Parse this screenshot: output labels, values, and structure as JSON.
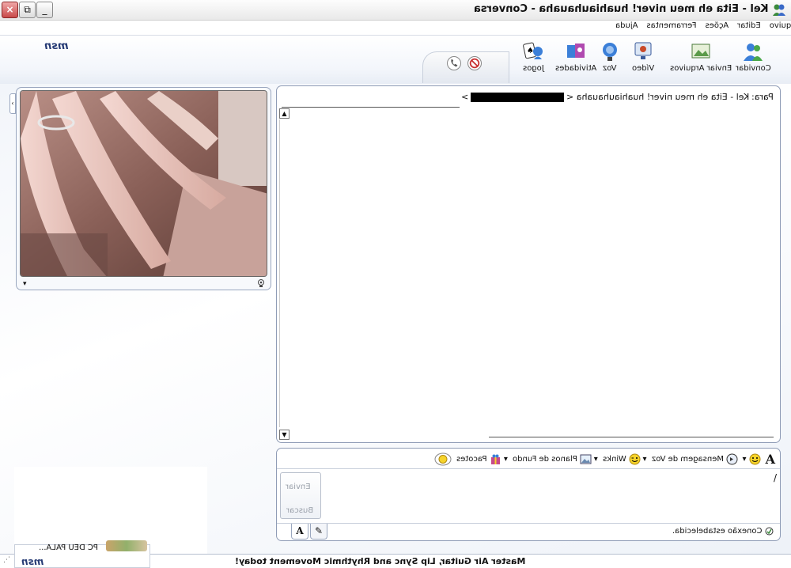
{
  "window": {
    "title": "Kel - Eita eh meu niver! huahiauhauaha - Conversa",
    "buttons": {
      "close": "×",
      "restore": "⧉",
      "minimize": "_"
    }
  },
  "menu": [
    "Arquivo",
    "Editar",
    "Ações",
    "Ferramentas",
    "Ajuda"
  ],
  "brand": {
    "logo": "msn"
  },
  "toolbar": {
    "items": [
      {
        "label": "Convidar",
        "icon": "invite-people-icon"
      },
      {
        "label": "Enviar Arquivos",
        "icon": "send-files-icon"
      },
      {
        "label": "Vídeo",
        "icon": "webcam-video-icon"
      },
      {
        "label": "Voz",
        "icon": "voice-microphone-icon"
      },
      {
        "label": "Atividades",
        "icon": "activities-icon"
      },
      {
        "label": "Jogos",
        "icon": "games-cards-icon"
      }
    ],
    "tab_icons": [
      "call-icon",
      "block-icon"
    ]
  },
  "webcam": {
    "expand_arrow": "▾",
    "settings_icon": "webcam-settings-icon"
  },
  "history": {
    "to_label": "Para:",
    "to_value": "Kel - Eita eh meu niver! huahiauhauaha <",
    "to_suffix": ">",
    "scroll_up": "▲",
    "scroll_down": "▼"
  },
  "format_bar": {
    "font_icon": "A",
    "emoticon_arrow": "▾",
    "voice_clip": "Mensagem de Voz",
    "winks": "Winks",
    "backgrounds": "Planos de Fundo",
    "packs": "Pacotes",
    "dropdown_arrow": "▾"
  },
  "compose": {
    "send_label": "Enviar",
    "search_label": "Buscar",
    "cursor": "/",
    "status": "Conexão estabelecida.",
    "tab_font": "A",
    "tab_ink": "✎"
  },
  "footer": {
    "ad_text": "Master Air Guitar, Lip Sync and Rhythmic Movement today!",
    "popup_text": "PC DEU PALA...",
    "logo": "msn"
  },
  "colors": {
    "accent": "#253a74",
    "border": "#8f9cb6",
    "close": "#c84a4a"
  }
}
